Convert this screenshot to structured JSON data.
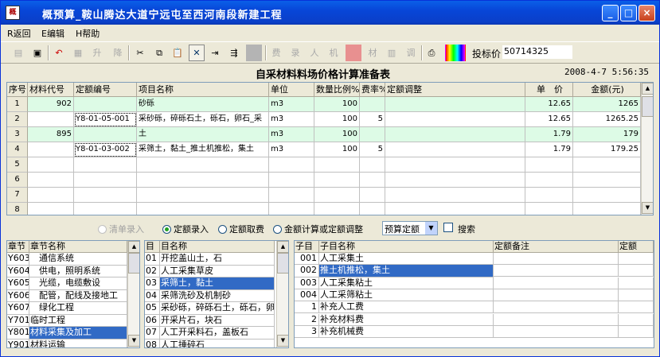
{
  "window": {
    "title": "概预算_鞍山腾达大道宁远屯至西河南段新建工程",
    "minimize": "_",
    "maximize": "□",
    "close": "×"
  },
  "menu": [
    "R返回",
    "E编辑",
    "H帮助"
  ],
  "toolbar": {
    "buttons": [
      "新建",
      "保存",
      "撤消",
      "取消",
      "升",
      "降",
      "剪切",
      "复制",
      "粘贴",
      "删除",
      "插入",
      "追加",
      "空",
      "费",
      "录",
      "人",
      "机",
      "颜色",
      "材",
      "换",
      "调",
      "打印",
      "色板"
    ],
    "bid_label": "投标价",
    "bid_value": "50714325"
  },
  "sheet": {
    "title": "自采材料料场价格计算准备表",
    "datetime": "2008-4-7  5:56:35",
    "columns": [
      "序号",
      "材料代号",
      "定额编号",
      "项目名称",
      "单位",
      "数量比例%",
      "费率%",
      "定额调整",
      "单　价",
      "金额(元)"
    ],
    "rows": [
      {
        "no": "1",
        "mat": "902",
        "quota": "",
        "name": "砂砾",
        "unit": "m3",
        "ratio": "100",
        "rate": "",
        "adj": "",
        "price": "12.65",
        "amount": "1265",
        "hl": true
      },
      {
        "no": "2",
        "mat": "",
        "quota": "Y8-01-05-001",
        "name": "采砂砾，碎砾石土，砾石，卵石_采",
        "unit": "m3",
        "ratio": "100",
        "rate": "5",
        "adj": "",
        "price": "12.65",
        "amount": "1265.25",
        "hl": false
      },
      {
        "no": "3",
        "mat": "895",
        "quota": "",
        "name": "土",
        "unit": "m3",
        "ratio": "100",
        "rate": "",
        "adj": "",
        "price": "1.79",
        "amount": "179",
        "hl": true
      },
      {
        "no": "4",
        "mat": "",
        "quota": "Y8-01-03-002",
        "name": "采筛土，黏土_推土机推松，集土",
        "unit": "m3",
        "ratio": "100",
        "rate": "5",
        "adj": "",
        "price": "1.79",
        "amount": "179.25",
        "hl": false
      },
      {
        "no": "5",
        "mat": "",
        "quota": "",
        "name": "",
        "unit": "",
        "ratio": "",
        "rate": "",
        "adj": "",
        "price": "",
        "amount": "",
        "hl": false
      },
      {
        "no": "6",
        "mat": "",
        "quota": "",
        "name": "",
        "unit": "",
        "ratio": "",
        "rate": "",
        "adj": "",
        "price": "",
        "amount": "",
        "hl": false
      },
      {
        "no": "7",
        "mat": "",
        "quota": "",
        "name": "",
        "unit": "",
        "ratio": "",
        "rate": "",
        "adj": "",
        "price": "",
        "amount": "",
        "hl": false
      },
      {
        "no": "8",
        "mat": "",
        "quota": "",
        "name": "",
        "unit": "",
        "ratio": "",
        "rate": "",
        "adj": "",
        "price": "",
        "amount": "",
        "hl": false
      }
    ]
  },
  "options": {
    "radios": [
      "清单录入",
      "定额录入",
      "定额取费",
      "金额计算或定额调整"
    ],
    "selected": "定额录入",
    "combo_value": "预算定额",
    "search_label": "搜索"
  },
  "chapters": {
    "columns": [
      "章节",
      "章节名称"
    ],
    "items": [
      {
        "code": "Y603",
        "name": "　通信系统"
      },
      {
        "code": "Y604",
        "name": "　供电，照明系统"
      },
      {
        "code": "Y605",
        "name": "　光缆，电缆敷设"
      },
      {
        "code": "Y606",
        "name": "　配管，配线及接地工"
      },
      {
        "code": "Y607",
        "name": "　绿化工程"
      },
      {
        "code": "Y701",
        "name": "临时工程"
      },
      {
        "code": "Y801",
        "name": "材料采集及加工",
        "sel": true
      },
      {
        "code": "Y901",
        "name": "材料运输"
      }
    ]
  },
  "categories": {
    "columns": [
      "目",
      "目名称"
    ],
    "items": [
      {
        "code": "01",
        "name": "开挖盖山土，石"
      },
      {
        "code": "02",
        "name": "人工采集草皮"
      },
      {
        "code": "03",
        "name": "采筛土，黏土",
        "sel": true
      },
      {
        "code": "04",
        "name": "采筛洗砂及机制砂"
      },
      {
        "code": "05",
        "name": "采砂砾，碎砾石土，砾石，卵石"
      },
      {
        "code": "06",
        "name": "开采片石，块石"
      },
      {
        "code": "07",
        "name": "人工开采料石，盖板石"
      },
      {
        "code": "08",
        "name": "人工捶碎石"
      }
    ]
  },
  "subitems": {
    "columns": [
      "子目",
      "子目名称",
      "定额备注",
      "定额"
    ],
    "items": [
      {
        "code": "001",
        "name": "人工采集土"
      },
      {
        "code": "002",
        "name": "推土机推松，集土",
        "sel": true
      },
      {
        "code": "003",
        "name": "人工采集粘土"
      },
      {
        "code": "004",
        "name": "人工采筛粘土"
      },
      {
        "code": "1",
        "name": "补充人工费"
      },
      {
        "code": "2",
        "name": "补充材料费"
      },
      {
        "code": "3",
        "name": "补充机械费"
      }
    ]
  }
}
